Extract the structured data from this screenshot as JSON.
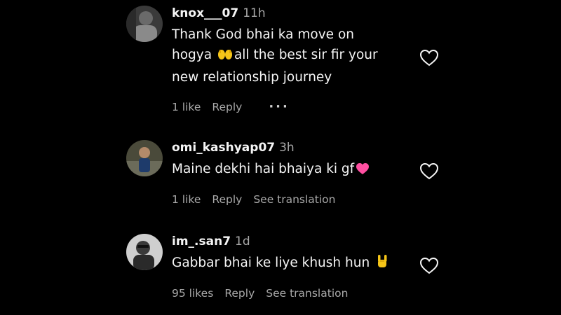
{
  "comments": [
    {
      "username": "knox___07",
      "time": "11h",
      "text_line1": "Thank God bhai ka move on",
      "text_line2a": "hogya ",
      "text_line2b": "all the best sir fir your",
      "text_line3": "new relationship journey",
      "likes": "1 like",
      "reply": "Reply",
      "more": "···",
      "emoji": "raising-hands-emoji"
    },
    {
      "username": "omi_kashyap07",
      "time": "3h",
      "text": "Maine dekhi hai bhaiya ki gf",
      "likes": "1 like",
      "reply": "Reply",
      "see_translation": "See translation",
      "emoji": "pink-heart-emoji"
    },
    {
      "username": "im_.san7",
      "time": "1d",
      "text": "Gabbar bhai ke liye khush hun ",
      "likes": "95 likes",
      "reply": "Reply",
      "see_translation": "See translation",
      "emoji": "rock-on-hand-emoji"
    }
  ],
  "colors": {
    "background": "#000000",
    "primary_text": "#f5f5f5",
    "secondary_text": "#a8a8a8",
    "heart_outline": "#f5f5f5",
    "pink_heart": "#ff4fa1",
    "emoji_yellow": "#f5c518"
  }
}
